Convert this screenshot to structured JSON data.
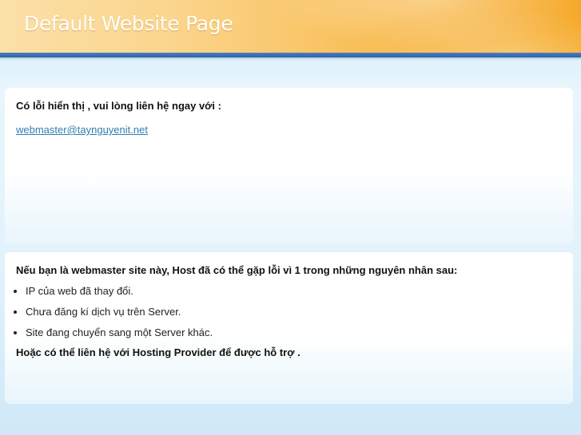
{
  "header": {
    "title": "Default Website Page"
  },
  "notice": {
    "heading": "Có lỗi hiển thị , vui lòng liên hệ ngay với :",
    "email": "webmaster@taynguyenit.net"
  },
  "info": {
    "heading": "Nếu bạn là webmaster site này, Host đã có thể gặp lỗi vì 1 trong những nguyên nhân sau:",
    "reasons": [
      "IP của web đã thay đổi.",
      "Chưa đăng kí dịch vụ trên Server.",
      "Site đang chuyển sang một Server khác."
    ],
    "footer": "Hoặc có thể liên hệ với Hosting Provider để được hỗ trợ ."
  },
  "colors": {
    "header_orange": "#f5a623",
    "header_bar_blue": "#2f62a6",
    "link_blue": "#2f7fb2",
    "background_blue": "#e3f3fb"
  }
}
